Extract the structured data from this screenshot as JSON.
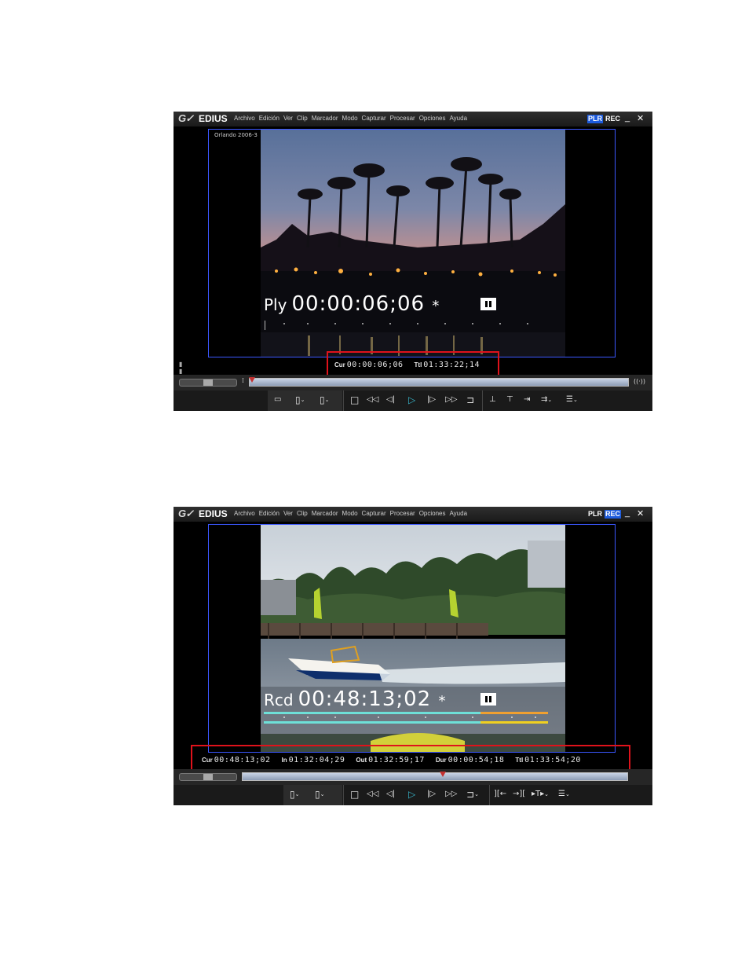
{
  "menu_items": [
    "Archivo",
    "Edición",
    "Ver",
    "Clip",
    "Marcador",
    "Modo",
    "Capturar",
    "Procesar",
    "Opciones",
    "Ayuda"
  ],
  "window1": {
    "logo": "G✓",
    "brand": "EDIUS",
    "mode_plr": "PLR",
    "mode_rec": "REC",
    "active_mode": "PLR",
    "clip_name": "Orlando 2006-3",
    "overlay_prefix": "Ply",
    "overlay_timecode": "00:00:06;06",
    "overlay_star": "*",
    "cur_label": "Cur",
    "cur_value": "00:00:06;06",
    "ttl_label": "Ttl",
    "ttl_value": "01:33:22;14",
    "playhead_fraction": 0.0
  },
  "window2": {
    "logo": "G✓",
    "brand": "EDIUS",
    "mode_plr": "PLR",
    "mode_rec": "REC",
    "active_mode": "REC",
    "overlay_prefix": "Rcd",
    "overlay_timecode": "00:48:13;02",
    "overlay_star": "*",
    "cur_label": "Cur",
    "cur_value": "00:48:13;02",
    "in_label": "In",
    "in_value": "01:32:04;29",
    "out_label": "Out",
    "out_value": "01:32:59;17",
    "dur_label": "Dur",
    "dur_value": "00:00:54;18",
    "ttl_label": "Ttl",
    "ttl_value": "01:33:54;20",
    "playhead_fraction": 0.52
  },
  "controls": {
    "minimize": "_",
    "close": "✕",
    "stop": "□",
    "rewind": "◁◁",
    "step_back": "◁|",
    "play": "▷",
    "step_forward": "|▷",
    "fast_forward": "▷▷",
    "loop": "⊐",
    "set_in": "▯",
    "set_out": "▯",
    "dropdown": "⌄"
  },
  "colors": {
    "accent_blue": "#1d5bdc",
    "highlight_red": "#e0121b",
    "play_cyan": "#38b7cc"
  }
}
